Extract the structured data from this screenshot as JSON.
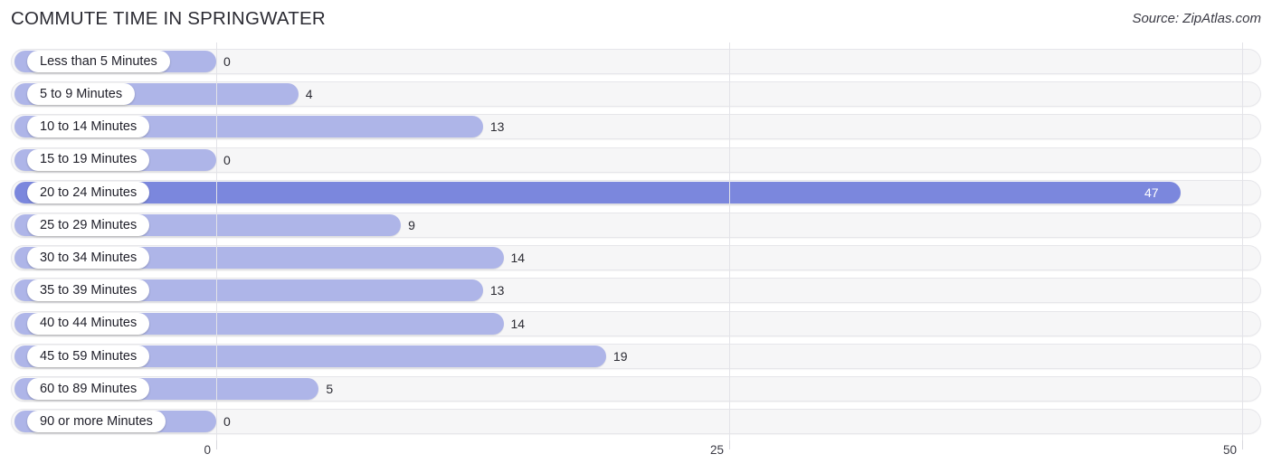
{
  "header": {
    "title": "COMMUTE TIME IN SPRINGWATER",
    "source": "Source: ZipAtlas.com"
  },
  "colors": {
    "bar": "#aeb5e8",
    "bar_max": "#7b87dd",
    "track": "#f6f6f7",
    "gridline": "#e3e3e8",
    "text": "#2b2b33"
  },
  "chart_data": {
    "type": "bar",
    "orientation": "horizontal",
    "title": "COMMUTE TIME IN SPRINGWATER",
    "xlabel": "",
    "ylabel": "",
    "xlim": [
      0,
      50
    ],
    "grid": true,
    "legend": null,
    "xticks": [
      0,
      25,
      50
    ],
    "xtick_labels": [
      "0",
      "25",
      "50"
    ],
    "highlight_max": true,
    "categories": [
      "Less than 5 Minutes",
      "5 to 9 Minutes",
      "10 to 14 Minutes",
      "15 to 19 Minutes",
      "20 to 24 Minutes",
      "25 to 29 Minutes",
      "30 to 34 Minutes",
      "35 to 39 Minutes",
      "40 to 44 Minutes",
      "45 to 59 Minutes",
      "60 to 89 Minutes",
      "90 or more Minutes"
    ],
    "values": [
      0,
      4,
      13,
      0,
      47,
      9,
      14,
      13,
      14,
      19,
      5,
      0
    ],
    "value_labels": [
      "0",
      "4",
      "13",
      "0",
      "47",
      "9",
      "14",
      "13",
      "14",
      "19",
      "5",
      "0"
    ]
  },
  "axis": {
    "ticks": [
      {
        "label": "0",
        "value": 0
      },
      {
        "label": "25",
        "value": 25
      },
      {
        "label": "50",
        "value": 50
      }
    ]
  }
}
